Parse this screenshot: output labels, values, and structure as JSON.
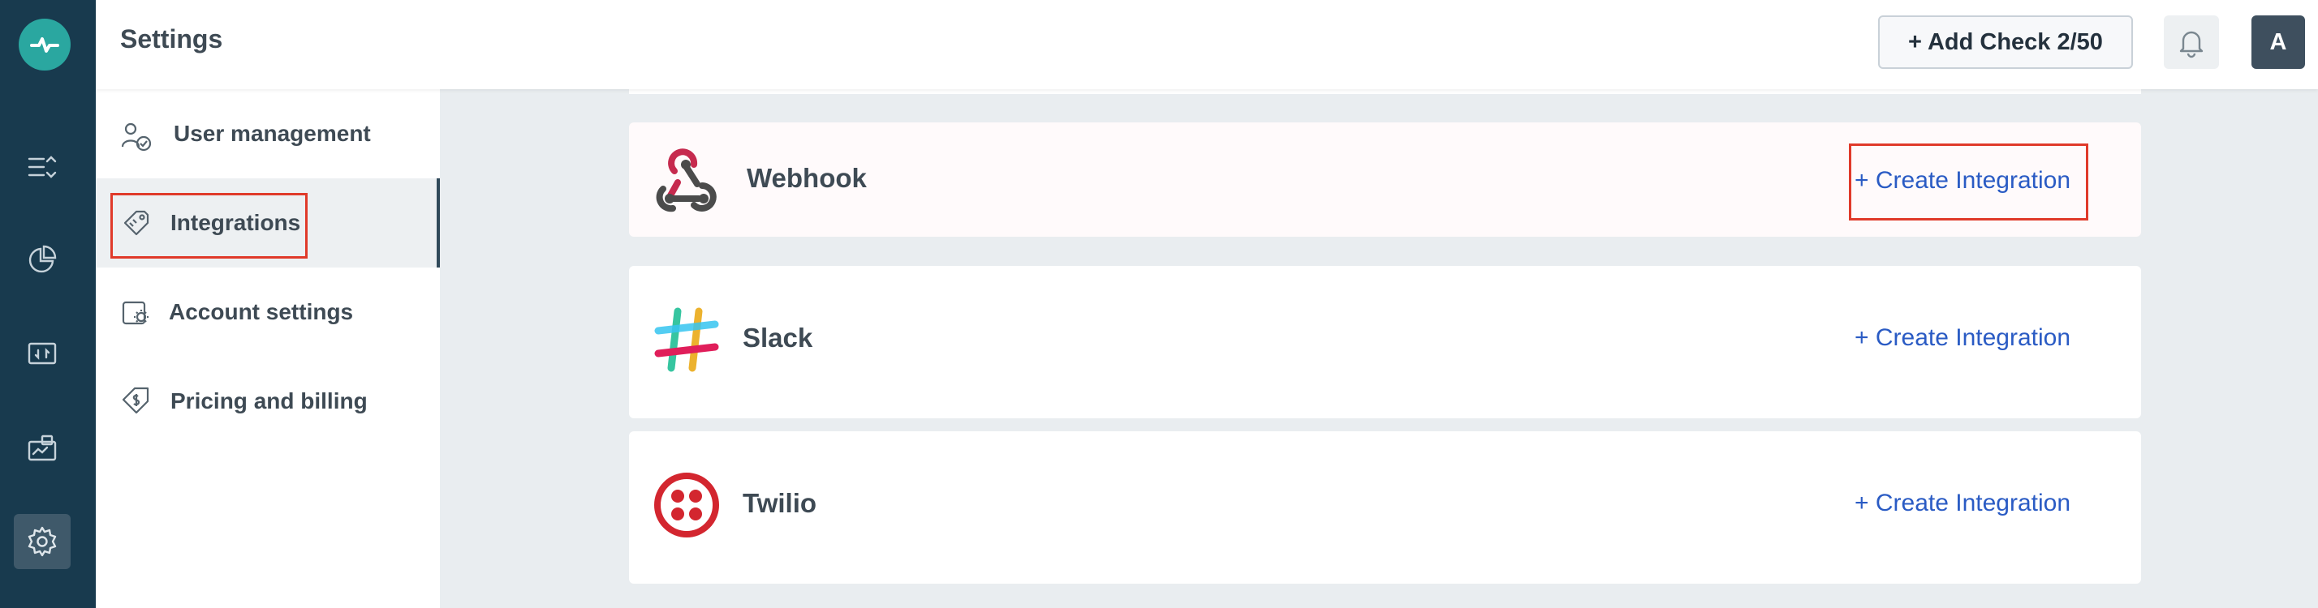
{
  "header": {
    "title": "Settings",
    "add_check_label": "+ Add Check 2/50",
    "avatar_initial": "A"
  },
  "rail": {
    "items": [
      {
        "icon": "checks-list-icon"
      },
      {
        "icon": "reports-pie-icon"
      },
      {
        "icon": "status-monitor-icon"
      },
      {
        "icon": "status-page-icon"
      },
      {
        "icon": "settings-gear-icon",
        "active": true
      }
    ]
  },
  "settings_menu": {
    "items": [
      {
        "label": "User management",
        "icon": "user-check-icon"
      },
      {
        "label": "Integrations",
        "icon": "plug-tag-icon",
        "active": true
      },
      {
        "label": "Account settings",
        "icon": "account-gear-icon"
      },
      {
        "label": "Pricing and billing",
        "icon": "price-tag-icon"
      }
    ]
  },
  "integrations": [
    {
      "name": "Webhook",
      "action": "+ Create Integration"
    },
    {
      "name": "Slack",
      "action": "+ Create Integration"
    },
    {
      "name": "Twilio",
      "action": "+ Create Integration"
    }
  ],
  "colors": {
    "rail": "#183a4e",
    "accent_link": "#2a5bc4",
    "highlight": "#e03a2a",
    "twilio": "#d3262f"
  }
}
